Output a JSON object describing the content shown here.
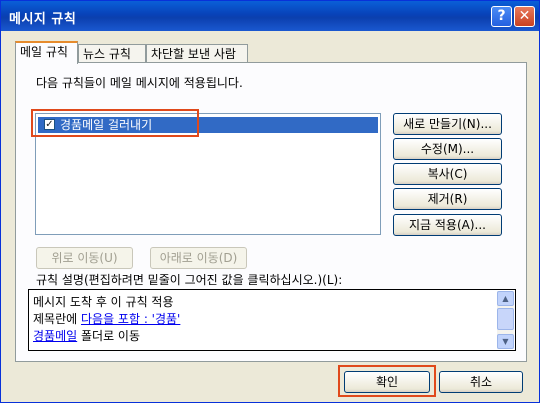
{
  "window": {
    "title": "메시지 규칙",
    "help_glyph": "?",
    "close_glyph": "✕"
  },
  "tabs": [
    {
      "label": "메일 규칙"
    },
    {
      "label": "뉴스 규칙"
    },
    {
      "label": "차단할 보낸 사람"
    }
  ],
  "rules_label": "다음 규칙들이 메일 메시지에 적용됩니다.",
  "rules": [
    {
      "name": "경품메일 걸러내기",
      "checked": true,
      "check_glyph": "✓"
    }
  ],
  "side_buttons": {
    "new": "새로 만들기(N)...",
    "modify": "수정(M)...",
    "copy": "복사(C)",
    "remove": "제거(R)",
    "apply_now": "지금 적용(A)..."
  },
  "move_up": "위로 이동(U)",
  "move_down": "아래로 이동(D)",
  "description_label": "규칙 설명(편집하려면 밑줄이 그어진 값을 클릭하십시오.)(L):",
  "description": {
    "line1": "메시지 도착 후 이 규칙 적용",
    "line2_prefix": "제목란에 ",
    "line2_link": "다음을 포함 : '경품'",
    "line3_link": "경품메일",
    "line3_suffix": " 폴더로 이동"
  },
  "scroll_glyphs": {
    "up": "▲",
    "down": "▼"
  },
  "footer": {
    "ok": "확인",
    "cancel": "취소"
  },
  "highlight_color": "#e0491b"
}
